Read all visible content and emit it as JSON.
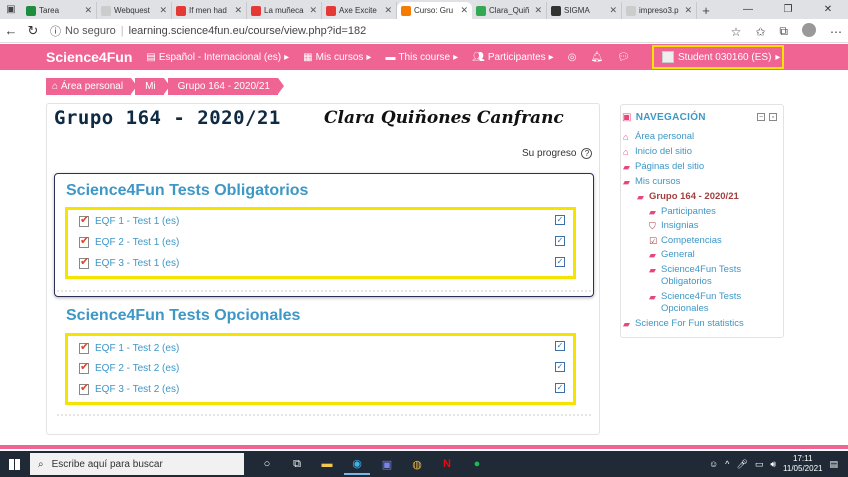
{
  "browser": {
    "tabs": [
      {
        "title": "Tarea",
        "color": "#1e8e3e",
        "active": false
      },
      {
        "title": "Webquest",
        "color": "#cccccc",
        "active": false
      },
      {
        "title": "If men had",
        "color": "#e53935",
        "active": false
      },
      {
        "title": "La muñeca",
        "color": "#e53935",
        "active": false
      },
      {
        "title": "Axe Excite",
        "color": "#e53935",
        "active": false
      },
      {
        "title": "Curso: Gru",
        "color": "#f57c00",
        "active": true
      },
      {
        "title": "Clara_Quiñ",
        "color": "#34a853",
        "active": false
      },
      {
        "title": "SIGMA",
        "color": "#333333",
        "active": false
      },
      {
        "title": "impreso3.p",
        "color": "#cccccc",
        "active": false
      }
    ],
    "new_tab": "+",
    "insecure_label": "No seguro",
    "url": "learning.science4fun.eu/course/view.php?id=182"
  },
  "navbar": {
    "brand": "Science4Fun",
    "language": "Español - Internacional (es)",
    "my_courses": "Mis cursos",
    "this_course": "This course",
    "participants": "Participantes",
    "user": "Student 030160 (ES)"
  },
  "breadcrumb": [
    "Área personal",
    "Mi",
    "Grupo 164 - 2020/21"
  ],
  "course": {
    "title": "Grupo 164 - 2020/21",
    "handwritten_name": "Clara Quiñones Canfranc",
    "progress_label": "Su progreso",
    "progress_help": "?"
  },
  "sections": [
    {
      "title": "Science4Fun Tests Obligatorios",
      "activities": [
        "EQF 1 - Test 1 (es)",
        "EQF 2 - Test 1 (es)",
        "EQF 3 - Test 1 (es)"
      ]
    },
    {
      "title": "Science4Fun Tests Opcionales",
      "activities": [
        "EQF 1 - Test 2 (es)",
        "EQF 2 - Test 2 (es)",
        "EQF 3 - Test 2 (es)"
      ]
    }
  ],
  "navigation": {
    "heading": "NAVEGACIÓN",
    "items": [
      {
        "label": "Área personal",
        "icon": "home-icon"
      },
      {
        "label": "Inicio del sitio",
        "icon": "home-icon"
      },
      {
        "label": "Páginas del sitio",
        "icon": "folder-icon"
      },
      {
        "label": "Mis cursos",
        "icon": "folder-icon"
      },
      {
        "label": "Grupo 164 - 2020/21",
        "icon": "folder-icon"
      },
      {
        "label": "Participantes",
        "icon": "folder-icon"
      },
      {
        "label": "Insignias",
        "icon": "shield-icon"
      },
      {
        "label": "Competencias",
        "icon": "checkbox-icon"
      },
      {
        "label": "General",
        "icon": "folder-icon"
      },
      {
        "label": "Science4Fun Tests Obligatorios",
        "icon": "folder-icon"
      },
      {
        "label": "Science4Fun Tests Opcionales",
        "icon": "folder-icon"
      },
      {
        "label": "Science For Fun statistics",
        "icon": "folder-icon"
      }
    ]
  },
  "taskbar": {
    "search_placeholder": "Escribe aquí para buscar",
    "time": "17:11",
    "date": "11/05/2021"
  }
}
